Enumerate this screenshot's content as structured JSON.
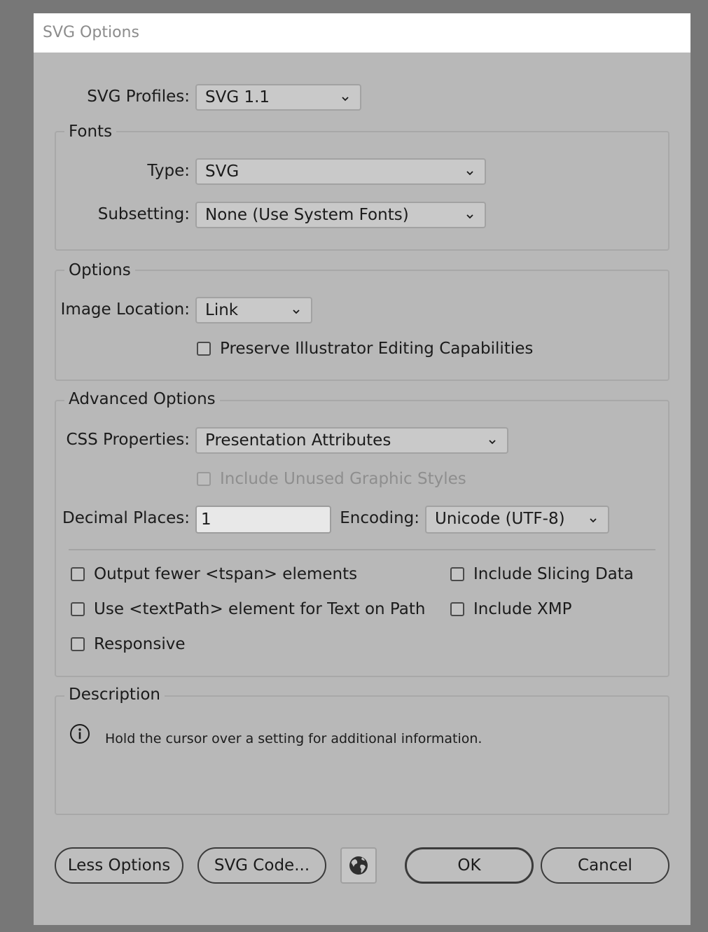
{
  "title": "SVG Options",
  "svg_profiles": {
    "label": "SVG Profiles:",
    "value": "SVG 1.1"
  },
  "fonts": {
    "group_title": "Fonts",
    "type_label": "Type:",
    "type_value": "SVG",
    "subsetting_label": "Subsetting:",
    "subsetting_value": "None (Use System Fonts)"
  },
  "options": {
    "group_title": "Options",
    "image_location_label": "Image Location:",
    "image_location_value": "Link",
    "preserve_label": "Preserve Illustrator Editing Capabilities",
    "preserve_checked": false
  },
  "advanced": {
    "group_title": "Advanced Options",
    "css_label": "CSS Properties:",
    "css_value": "Presentation Attributes",
    "unused_styles_label": "Include Unused Graphic Styles",
    "unused_styles_disabled": true,
    "decimal_label": "Decimal Places:",
    "decimal_value": "1",
    "encoding_label": "Encoding:",
    "encoding_value": "Unicode (UTF-8)",
    "checkboxes": {
      "tspan": "Output fewer <tspan> elements",
      "textpath": "Use <textPath> element for Text on Path",
      "responsive": "Responsive",
      "slicing": "Include Slicing Data",
      "xmp": "Include XMP"
    }
  },
  "description": {
    "group_title": "Description",
    "icon": "info-icon",
    "text": "Hold the cursor over a setting for additional information."
  },
  "buttons": {
    "less_options": "Less Options",
    "svg_code": "SVG Code...",
    "web_icon": "globe-icon",
    "ok": "OK",
    "cancel": "Cancel"
  },
  "colors": {
    "dialog_bg": "#b8b8b8",
    "backdrop": "#777777",
    "titlebar": "#ffffff"
  }
}
